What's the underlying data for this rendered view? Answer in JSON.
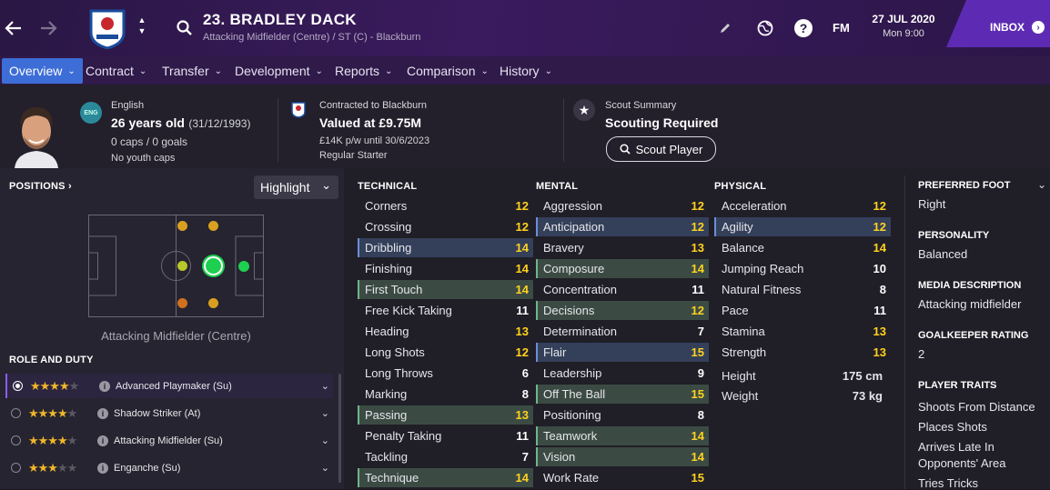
{
  "header": {
    "player_title": "23. BRADLEY DACK",
    "player_subtitle": "Attacking Midfielder (Centre) / ST (C) - Blackburn",
    "fm_label": "FM",
    "date": "27 JUL 2020",
    "time": "Mon 9:00",
    "inbox_label": "INBOX"
  },
  "tabs": [
    {
      "label": "Overview"
    },
    {
      "label": "Contract"
    },
    {
      "label": "Transfer"
    },
    {
      "label": "Development"
    },
    {
      "label": "Reports"
    },
    {
      "label": "Comparison"
    },
    {
      "label": "History"
    }
  ],
  "info": {
    "nationality": "English",
    "nation_badge": "ENG",
    "age": "26 years old",
    "dob": "(31/12/1993)",
    "caps": "0 caps / 0 goals",
    "youth_caps": "No youth caps",
    "contract_club": "Contracted to Blackburn",
    "value": "Valued at £9.75M",
    "wage": "£14K p/w until 30/6/2023",
    "squad_status": "Regular Starter",
    "scout_heading": "Scout Summary",
    "scout_status": "Scouting Required",
    "scout_button": "Scout Player"
  },
  "positions": {
    "title": "POSITIONS",
    "highlight_label": "Highlight",
    "position_name": "Attacking Midfielder (Centre)"
  },
  "roles": {
    "title": "ROLE AND DUTY",
    "items": [
      {
        "label": "Advanced Playmaker (Su)",
        "stars": 3.5
      },
      {
        "label": "Shadow Striker (At)",
        "stars": 3.5
      },
      {
        "label": "Attacking Midfielder (Su)",
        "stars": 3.5
      },
      {
        "label": "Enganche (Su)",
        "stars": 3
      }
    ]
  },
  "technical": {
    "title": "TECHNICAL",
    "rows": [
      {
        "name": "Corners",
        "value": "12"
      },
      {
        "name": "Crossing",
        "value": "12"
      },
      {
        "name": "Dribbling",
        "value": "14"
      },
      {
        "name": "Finishing",
        "value": "14"
      },
      {
        "name": "First Touch",
        "value": "14"
      },
      {
        "name": "Free Kick Taking",
        "value": "11"
      },
      {
        "name": "Heading",
        "value": "13"
      },
      {
        "name": "Long Shots",
        "value": "12"
      },
      {
        "name": "Long Throws",
        "value": "6"
      },
      {
        "name": "Marking",
        "value": "8"
      },
      {
        "name": "Passing",
        "value": "13"
      },
      {
        "name": "Penalty Taking",
        "value": "11"
      },
      {
        "name": "Tackling",
        "value": "7"
      },
      {
        "name": "Technique",
        "value": "14"
      }
    ]
  },
  "mental": {
    "title": "MENTAL",
    "rows": [
      {
        "name": "Aggression",
        "value": "12"
      },
      {
        "name": "Anticipation",
        "value": "12"
      },
      {
        "name": "Bravery",
        "value": "13"
      },
      {
        "name": "Composure",
        "value": "14"
      },
      {
        "name": "Concentration",
        "value": "11"
      },
      {
        "name": "Decisions",
        "value": "12"
      },
      {
        "name": "Determination",
        "value": "7"
      },
      {
        "name": "Flair",
        "value": "15"
      },
      {
        "name": "Leadership",
        "value": "9"
      },
      {
        "name": "Off The Ball",
        "value": "15"
      },
      {
        "name": "Positioning",
        "value": "8"
      },
      {
        "name": "Teamwork",
        "value": "14"
      },
      {
        "name": "Vision",
        "value": "14"
      },
      {
        "name": "Work Rate",
        "value": "15"
      }
    ]
  },
  "physical": {
    "title": "PHYSICAL",
    "rows": [
      {
        "name": "Acceleration",
        "value": "12"
      },
      {
        "name": "Agility",
        "value": "12"
      },
      {
        "name": "Balance",
        "value": "14"
      },
      {
        "name": "Jumping Reach",
        "value": "10"
      },
      {
        "name": "Natural Fitness",
        "value": "8"
      },
      {
        "name": "Pace",
        "value": "11"
      },
      {
        "name": "Stamina",
        "value": "13"
      },
      {
        "name": "Strength",
        "value": "13"
      }
    ],
    "height_label": "Height",
    "height_value": "175 cm",
    "weight_label": "Weight",
    "weight_value": "73 kg"
  },
  "side": {
    "foot_title": "PREFERRED FOOT",
    "foot_value": "Right",
    "personality_title": "PERSONALITY",
    "personality_value": "Balanced",
    "media_title": "MEDIA DESCRIPTION",
    "media_value": "Attacking midfielder",
    "gk_title": "GOALKEEPER RATING",
    "gk_value": "2",
    "traits_title": "PLAYER TRAITS",
    "traits": [
      "Shoots From Distance",
      "Places Shots",
      "Arrives Late In",
      "Opponents' Area",
      "Tries Tricks"
    ]
  },
  "colors": {
    "accent": "#3d6dd6",
    "inbox": "#5d2bb3",
    "highlight_value": "#ffd21e"
  }
}
